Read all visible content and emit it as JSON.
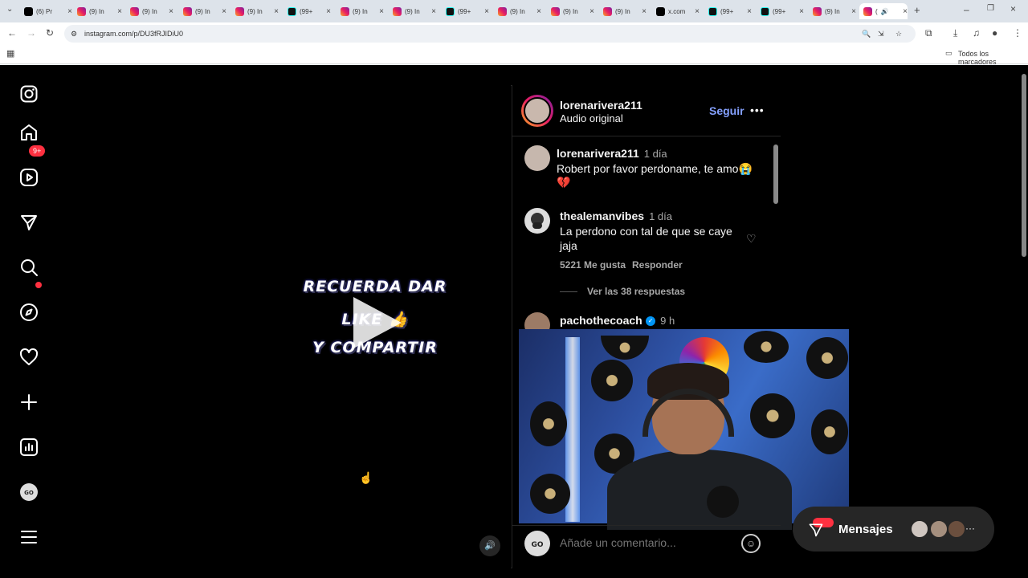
{
  "browser": {
    "tabs": [
      {
        "title": "(6) Pr",
        "favicon": "x-icon"
      },
      {
        "title": "(9) In",
        "favicon": "instagram-icon"
      },
      {
        "title": "(9) In",
        "favicon": "instagram-icon"
      },
      {
        "title": "(9) In",
        "favicon": "instagram-icon"
      },
      {
        "title": "(9) In",
        "favicon": "instagram-icon"
      },
      {
        "title": "(99+",
        "favicon": "tiktok-icon"
      },
      {
        "title": "(9) In",
        "favicon": "instagram-icon"
      },
      {
        "title": "(9) In",
        "favicon": "instagram-icon"
      },
      {
        "title": "(99+",
        "favicon": "tiktok-icon"
      },
      {
        "title": "(9) In",
        "favicon": "instagram-icon"
      },
      {
        "title": "(9) In",
        "favicon": "instagram-icon"
      },
      {
        "title": "(9) In",
        "favicon": "instagram-icon"
      },
      {
        "title": "x.com",
        "favicon": "x-icon"
      },
      {
        "title": "(99+",
        "favicon": "tiktok-icon"
      },
      {
        "title": "(99+",
        "favicon": "tiktok-icon"
      },
      {
        "title": "(9) In",
        "favicon": "instagram-icon"
      },
      {
        "title": "(",
        "favicon": "instagram-icon"
      }
    ],
    "url": "instagram.com/p/DU3fRJIDiU0",
    "bookmarks_label": "Todos los marcadores"
  },
  "sidebar": {
    "items": [
      {
        "name": "instagram-logo-icon"
      },
      {
        "name": "home-icon"
      },
      {
        "name": "reels-icon"
      },
      {
        "name": "messages-icon"
      },
      {
        "name": "search-icon"
      },
      {
        "name": "explore-icon"
      },
      {
        "name": "notifications-icon"
      },
      {
        "name": "create-icon"
      },
      {
        "name": "dashboard-icon"
      },
      {
        "name": "profile-icon"
      },
      {
        "name": "menu-icon"
      }
    ],
    "messages_badge": "9+"
  },
  "video": {
    "line1": "RECUERDA DAR",
    "line2": "LIKE 👍",
    "line3": "Y COMPARTIR"
  },
  "post": {
    "author": "lorenarivera211",
    "audio": "Audio original",
    "follow": "Seguir",
    "more": "•••"
  },
  "comments": [
    {
      "user": "lorenarivera211",
      "time": "1 día",
      "text": "Robert por favor perdoname, te amo😭",
      "text2": "💔"
    },
    {
      "user": "thealemanvibes",
      "time": "1 día",
      "text": "La perdono con tal de que se caye",
      "text2": "jaja",
      "likes": "5221 Me gusta",
      "reply": "Responder",
      "replies": "Ver las 38 respuestas"
    },
    {
      "user": "pachothecoach",
      "time": "9 h"
    }
  ],
  "composer": {
    "placeholder": "Añade un comentario..."
  },
  "messages_pill": {
    "label": "Mensajes"
  }
}
